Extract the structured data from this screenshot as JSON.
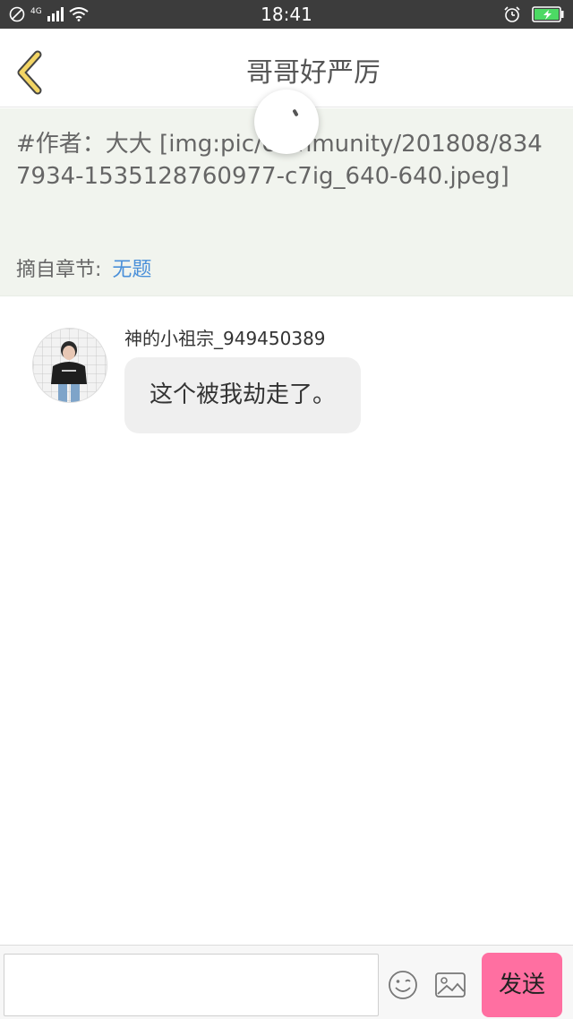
{
  "status_bar": {
    "time": "18:41",
    "network": "4G",
    "icons": [
      "no-disturb-icon",
      "signal-icon",
      "wifi-icon",
      "alarm-icon",
      "battery-charging-icon"
    ],
    "battery_color": "#4cd964"
  },
  "header": {
    "title": "哥哥好严厉",
    "back_icon": "chevron-left-icon",
    "accent": "#f3d564"
  },
  "quote": {
    "text": "#作者：大大 [img:pic/community/201808/8347934-1535128760977-c7ig_640-640.jpeg]",
    "chapter_label": "摘自章节:",
    "chapter_value": "无题",
    "link_color": "#4a90d9"
  },
  "messages": [
    {
      "username": "神的小祖宗_949450389",
      "text": "这个被我劫走了。",
      "avatar": "avatar"
    }
  ],
  "input_bar": {
    "placeholder": "",
    "emoji_icon": "emoji-icon",
    "image_icon": "image-icon",
    "send_label": "发送",
    "send_color": "#ff6fa1"
  }
}
